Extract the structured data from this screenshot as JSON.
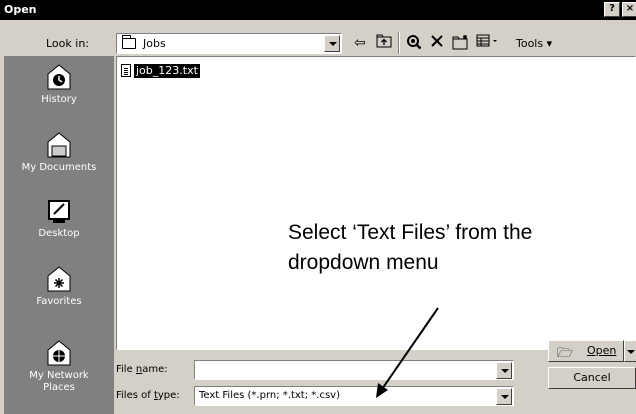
{
  "window": {
    "title": "Open",
    "help_label": "?",
    "close_label": "×"
  },
  "toolbar": {
    "look_in_label": "Look in:",
    "look_in_value": "Jobs",
    "tools_label": "Tools"
  },
  "places": [
    {
      "label": "History",
      "icon": "history-icon"
    },
    {
      "label": "My Documents",
      "icon": "my-documents-icon"
    },
    {
      "label": "Desktop",
      "icon": "desktop-icon"
    },
    {
      "label": "Favorites",
      "icon": "favorites-icon"
    },
    {
      "label": "My Network Places",
      "icon": "network-places-icon"
    }
  ],
  "files": [
    {
      "name": "job_123.txt",
      "selected": true
    }
  ],
  "annotation": {
    "line1": "Select ‘Text Files’ from the",
    "line2": "dropdown menu"
  },
  "form": {
    "file_name_label": "File name:",
    "file_name_value": "",
    "file_type_label": "Files of type:",
    "file_type_value": "Text Files (*.prn; *.txt; *.csv)",
    "open_label": "Open",
    "cancel_label": "Cancel"
  }
}
